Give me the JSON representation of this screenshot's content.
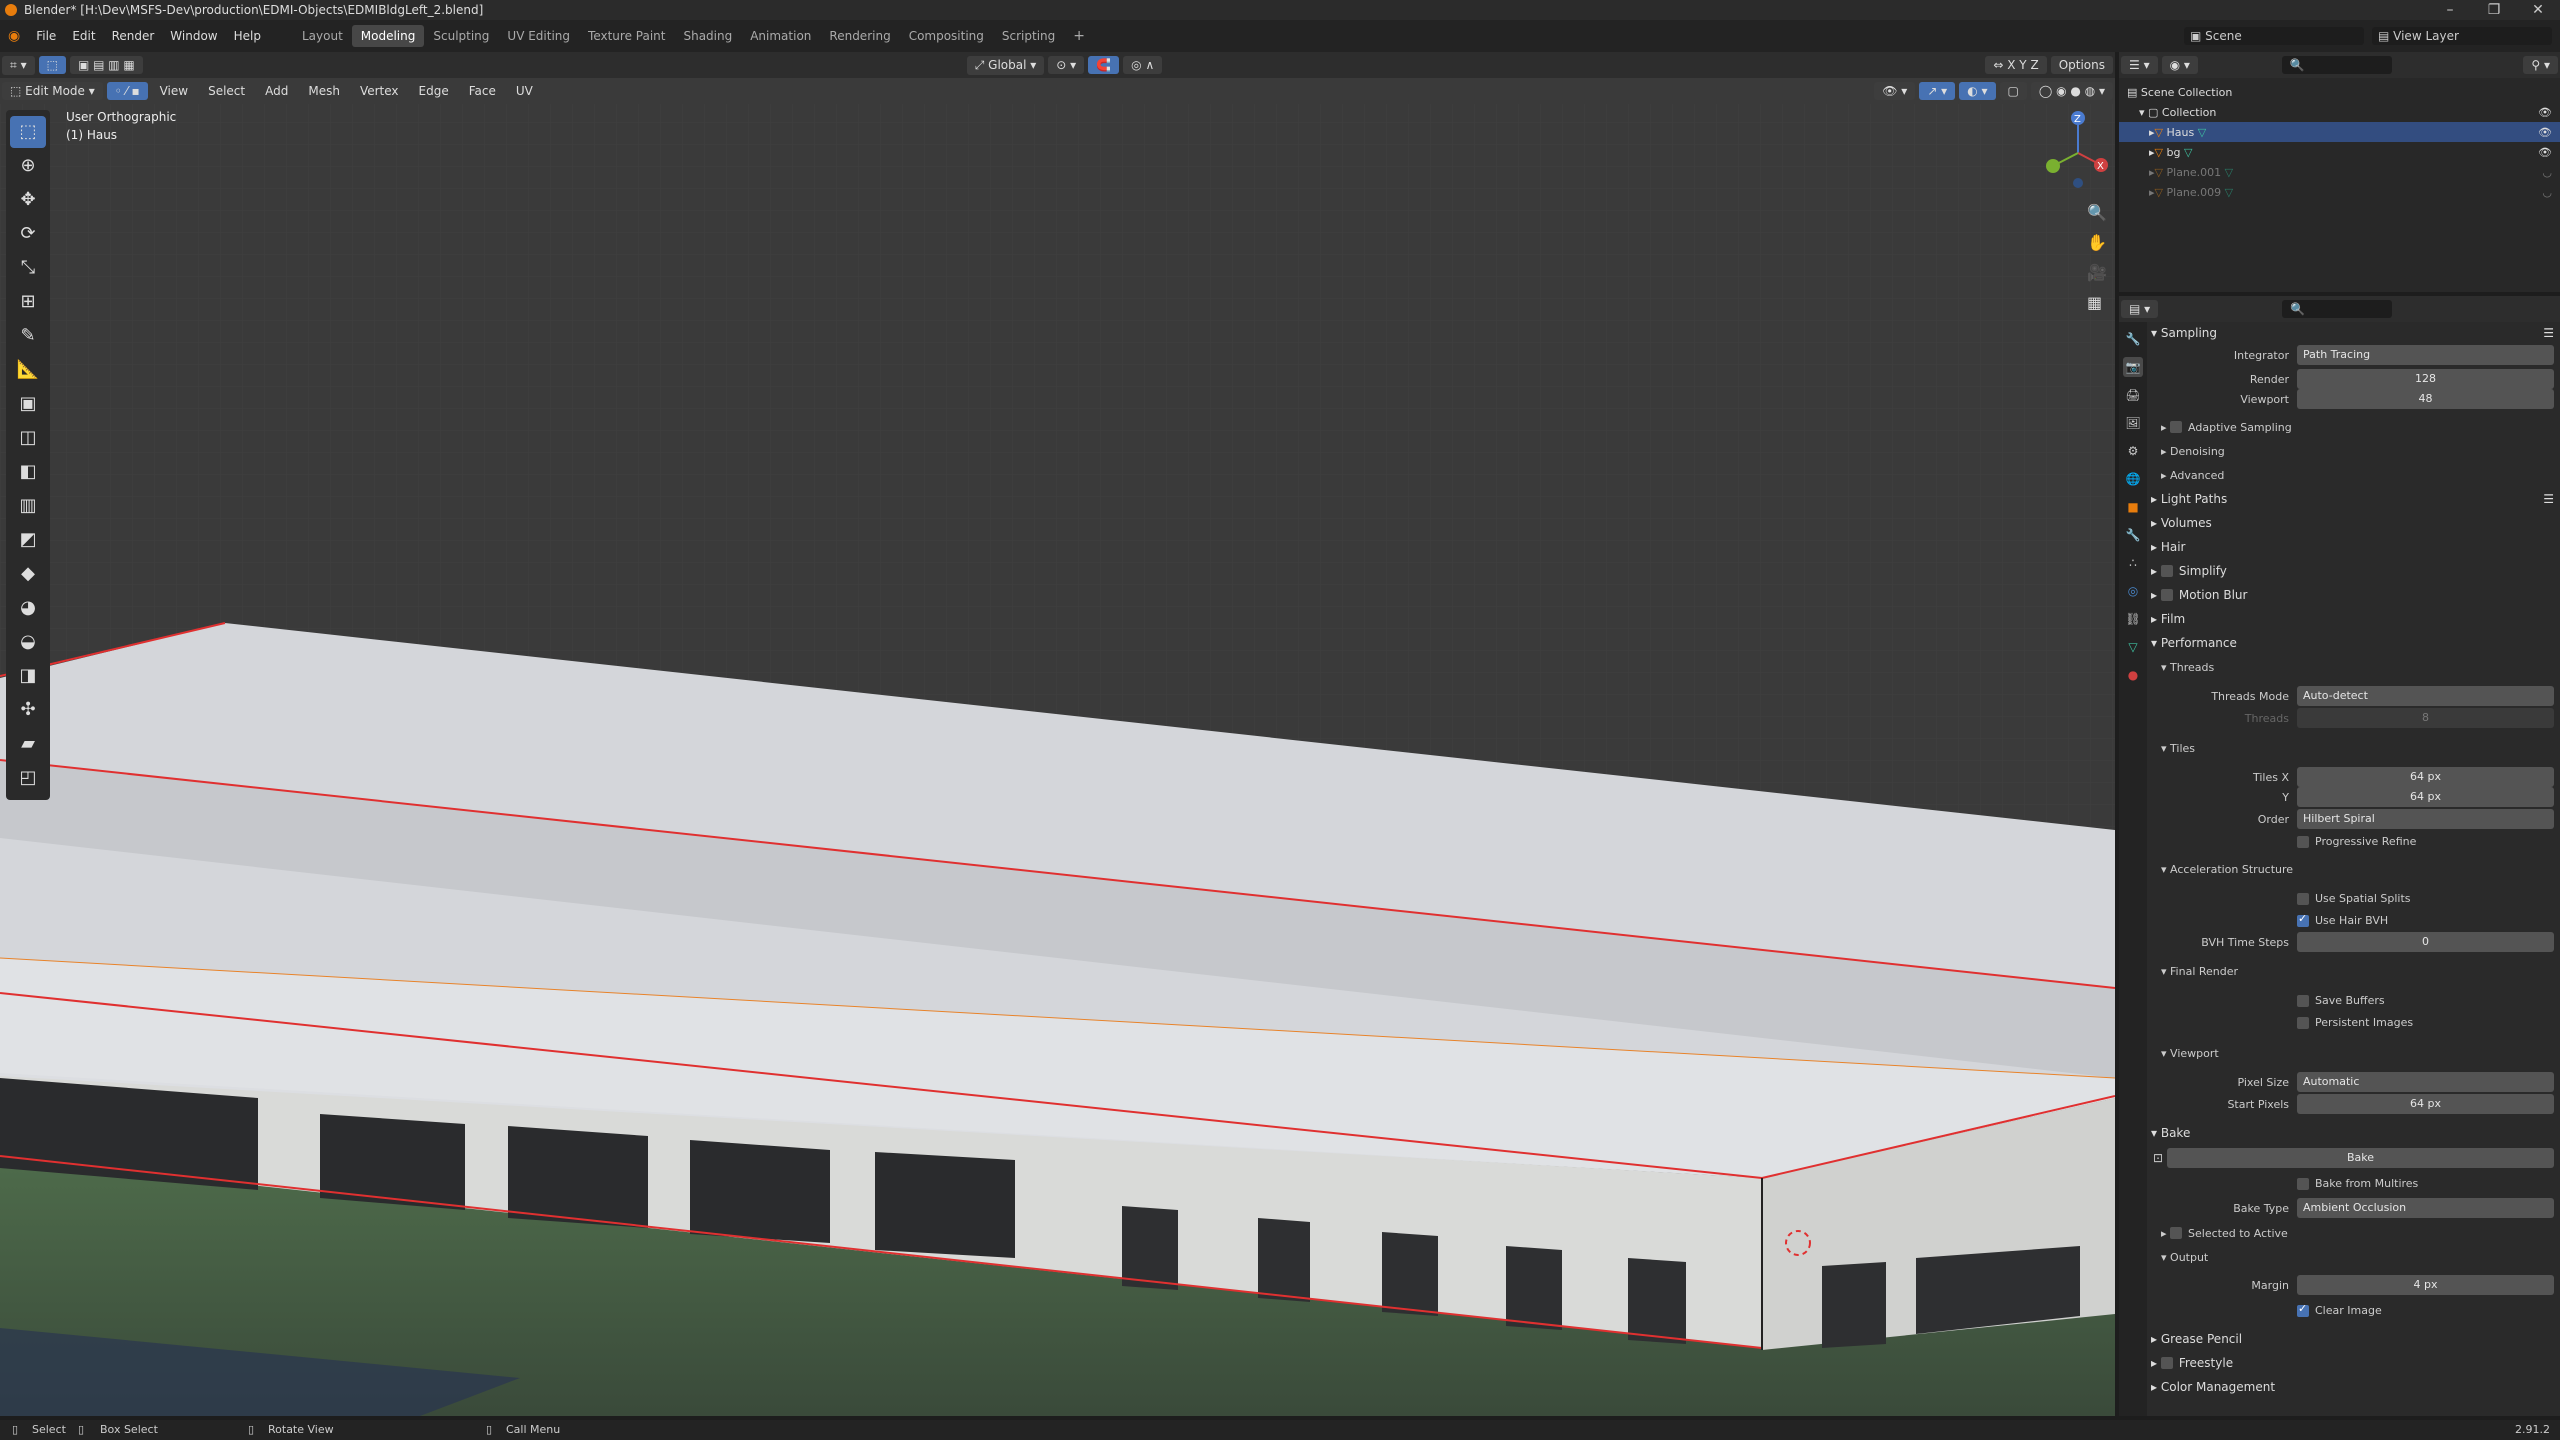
{
  "window": {
    "title": "Blender* [H:\\Dev\\MSFS-Dev\\production\\EDMI-Objects\\EDMIBldgLeft_2.blend]",
    "minimize": "–",
    "maximize": "❐",
    "close": "✕"
  },
  "menu": {
    "items": [
      "File",
      "Edit",
      "Render",
      "Window",
      "Help"
    ]
  },
  "workspaces": [
    "Layout",
    "Modeling",
    "Sculpting",
    "UV Editing",
    "Texture Paint",
    "Shading",
    "Animation",
    "Rendering",
    "Compositing",
    "Scripting"
  ],
  "active_workspace": "Modeling",
  "scene": {
    "name": "Scene",
    "view_layer": "View Layer"
  },
  "viewport_header": {
    "mode": "Edit Mode",
    "menus": [
      "View",
      "Select",
      "Add",
      "Mesh",
      "Vertex",
      "Edge",
      "Face",
      "UV"
    ],
    "orientation": "Global",
    "options": "Options",
    "axes": [
      "X",
      "Y",
      "Z"
    ]
  },
  "viewport": {
    "view_name": "User Orthographic",
    "object_label": "(1) Haus"
  },
  "gizmo": {
    "z": "Z",
    "y": "Y",
    "x": "X"
  },
  "outliner": {
    "scene_collection": "Scene Collection",
    "items": [
      {
        "name": "Collection",
        "type": "collection"
      },
      {
        "name": "Haus",
        "type": "mesh",
        "selected": true
      },
      {
        "name": "bg",
        "type": "mesh"
      },
      {
        "name": "Plane.001",
        "type": "mesh",
        "dim": true
      },
      {
        "name": "Plane.009",
        "type": "mesh",
        "dim": true
      }
    ]
  },
  "props": {
    "sampling": "Sampling",
    "integrator_label": "Integrator",
    "integrator": "Path Tracing",
    "render_label": "Render",
    "render": "128",
    "viewport_label": "Viewport",
    "viewport": "48",
    "adaptive": "Adaptive Sampling",
    "denoising": "Denoising",
    "advanced": "Advanced",
    "light_paths": "Light Paths",
    "volumes": "Volumes",
    "hair": "Hair",
    "simplify": "Simplify",
    "motion_blur": "Motion Blur",
    "film": "Film",
    "performance": "Performance",
    "threads": "Threads",
    "threads_mode_label": "Threads Mode",
    "threads_mode": "Auto-detect",
    "threads_count_label": "Threads",
    "threads_count": "8",
    "tiles": "Tiles",
    "tiles_x_label": "Tiles X",
    "tiles_x": "64 px",
    "tiles_y_label": "Y",
    "tiles_y": "64 px",
    "order_label": "Order",
    "order": "Hilbert Spiral",
    "progressive": "Progressive Refine",
    "accel": "Acceleration Structure",
    "spatial": "Use Spatial Splits",
    "hair_bvh": "Use Hair BVH",
    "bvh_label": "BVH Time Steps",
    "bvh": "0",
    "final_render": "Final Render",
    "save_buffers": "Save Buffers",
    "persistent": "Persistent Images",
    "vp_section": "Viewport",
    "pixel_size_label": "Pixel Size",
    "pixel_size": "Automatic",
    "start_pixels_label": "Start Pixels",
    "start_pixels": "64 px",
    "bake": "Bake",
    "bake_button": "Bake",
    "bake_multires": "Bake from Multires",
    "bake_type_label": "Bake Type",
    "bake_type": "Ambient Occlusion",
    "selected_to_active": "Selected to Active",
    "output": "Output",
    "margin_label": "Margin",
    "margin": "4 px",
    "clear_image": "Clear Image",
    "grease_pencil": "Grease Pencil",
    "freestyle": "Freestyle",
    "color_mgmt": "Color Management"
  },
  "status": {
    "select": "Select",
    "box_select": "Box Select",
    "rotate": "Rotate View",
    "call_menu": "Call Menu",
    "version": "2.91.2"
  },
  "colors": {
    "accent": "#4772b3",
    "edge_red": "#e03030",
    "orange": "#e87d0d"
  }
}
